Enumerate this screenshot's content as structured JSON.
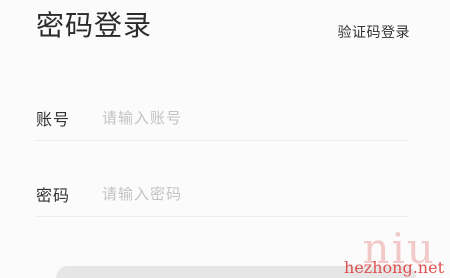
{
  "header": {
    "title": "密码登录",
    "switch_login_link": "验证码登录"
  },
  "form": {
    "account": {
      "label": "账号",
      "placeholder": "请输入账号",
      "value": ""
    },
    "password": {
      "label": "密码",
      "placeholder": "请输入密码",
      "value": ""
    }
  },
  "watermark": {
    "large": "niu",
    "small": "hezhong.net"
  }
}
